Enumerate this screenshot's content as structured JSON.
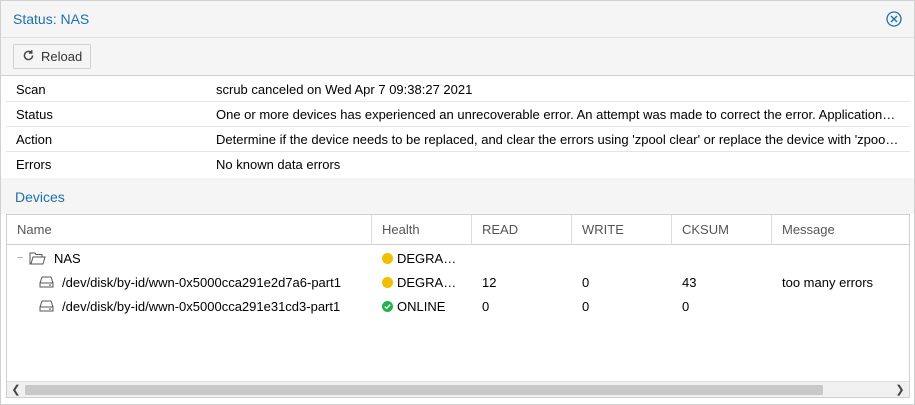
{
  "window": {
    "title": "Status: NAS",
    "close_icon": "close-icon"
  },
  "toolbar": {
    "reload_label": "Reload",
    "reload_icon": "refresh-icon"
  },
  "status": [
    {
      "key": "Scan",
      "value": "scrub canceled on Wed Apr 7 09:38:27 2021"
    },
    {
      "key": "Status",
      "value": "One or more devices has experienced an unrecoverable error. An attempt was made to correct the error. Application…"
    },
    {
      "key": "Action",
      "value": "Determine if the device needs to be replaced, and clear the errors using 'zpool clear' or replace the device with 'zpool…"
    },
    {
      "key": "Errors",
      "value": "No known data errors"
    }
  ],
  "devices": {
    "title": "Devices",
    "columns": [
      "Name",
      "Health",
      "READ",
      "WRITE",
      "CKSUM",
      "Message"
    ],
    "rows": [
      {
        "name": "NAS",
        "icon": "folder-icon",
        "health": "DEGRA…",
        "health_color": "#f0c000",
        "read": "",
        "write": "",
        "cksum": "",
        "message": ""
      },
      {
        "name": "/dev/disk/by-id/wwn-0x5000cca291e2d7a6-part1",
        "icon": "disk-icon",
        "health": "DEGRA…",
        "health_color": "#f0c000",
        "read": "12",
        "write": "0",
        "cksum": "43",
        "message": "too many errors"
      },
      {
        "name": "/dev/disk/by-id/wwn-0x5000cca291e31cd3-part1",
        "icon": "disk-icon",
        "health": "ONLINE",
        "health_color": "#21b24b",
        "read": "0",
        "write": "0",
        "cksum": "0",
        "message": ""
      }
    ]
  },
  "colors": {
    "accent": "#1e6fae",
    "warning": "#f0c000",
    "ok": "#21b24b"
  }
}
